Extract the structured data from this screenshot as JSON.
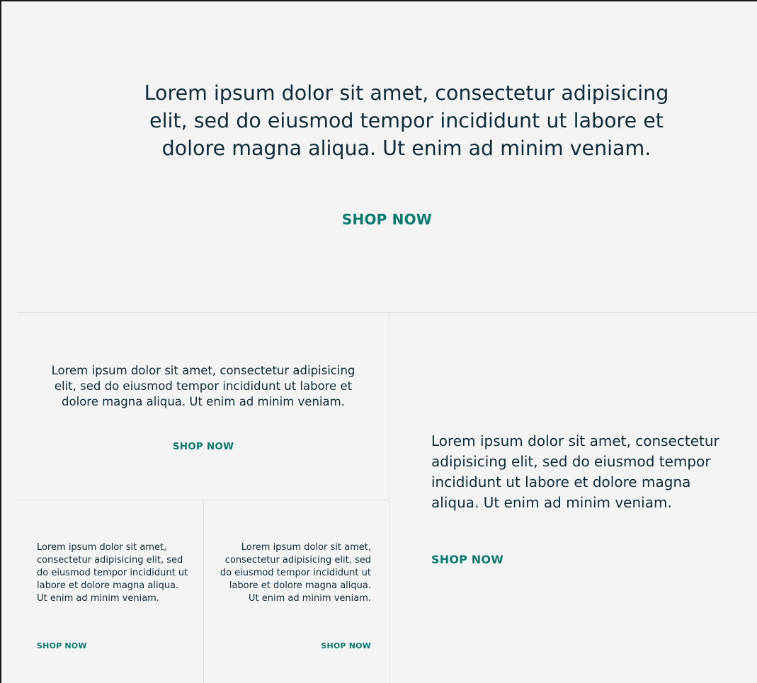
{
  "hero": {
    "text": "Lorem ipsum dolor sit amet, consectetur adipisicing elit, sed do eiusmod tempor incididunt ut labore et dolore magna aliqua. Ut enim ad minim veniam.",
    "cta": "SHOP NOW"
  },
  "tiles": {
    "middle_left": {
      "text": "Lorem ipsum dolor sit amet, consectetur adipisicing elit, sed do eiusmod tempor incididunt ut labore et dolore magna aliqua. Ut enim ad minim veniam.",
      "cta": "SHOP NOW"
    },
    "small_left": {
      "text": "Lorem ipsum dolor sit amet, consectetur adipisicing elit, sed do eiusmod tempor incididunt ut labore et dolore magna aliqua. Ut enim ad minim veniam.",
      "cta": "SHOP NOW"
    },
    "small_right": {
      "text": "Lorem ipsum dolor sit amet, consectetur adipisicing elit, sed do eiusmod tempor incididunt ut labore et dolore magna aliqua. Ut enim ad minim veniam.",
      "cta": "SHOP NOW"
    },
    "large_right": {
      "text": "Lorem ipsum dolor sit amet, consectetur adipisicing elit, sed do eiusmod tempor incididunt ut labore et dolore magna aliqua. Ut enim ad minim veniam.",
      "cta": "SHOP NOW"
    }
  },
  "colors": {
    "background": "#f4f4f4",
    "text": "#0f2a3a",
    "cta": "#0a7a6e",
    "divider": "#e2e2e2"
  }
}
